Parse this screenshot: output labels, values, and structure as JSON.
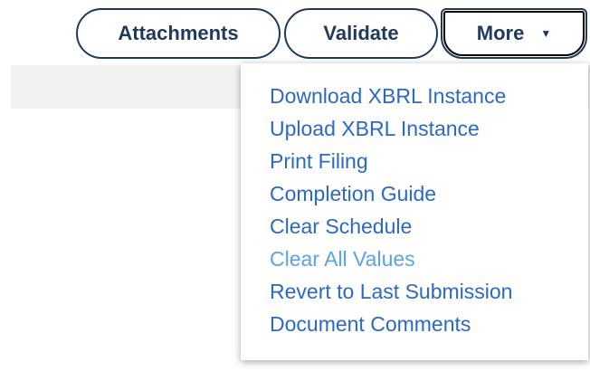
{
  "toolbar": {
    "attachments_label": "Attachments",
    "validate_label": "Validate",
    "more_label": "More",
    "more_caret": "▼"
  },
  "more_menu": {
    "items": [
      {
        "label": "Download XBRL Instance",
        "enabled": true
      },
      {
        "label": "Upload XBRL Instance",
        "enabled": true
      },
      {
        "label": "Print Filing",
        "enabled": true
      },
      {
        "label": "Completion Guide",
        "enabled": true
      },
      {
        "label": "Clear Schedule",
        "enabled": true
      },
      {
        "label": "Clear All Values",
        "enabled": false
      },
      {
        "label": "Revert to Last Submission",
        "enabled": true
      },
      {
        "label": "Document Comments",
        "enabled": true
      }
    ]
  },
  "colors": {
    "button_text": "#1f3a5c",
    "link": "#2a69c5",
    "link_disabled": "#5aa3e6",
    "strip_bg": "#f2f2f2"
  }
}
